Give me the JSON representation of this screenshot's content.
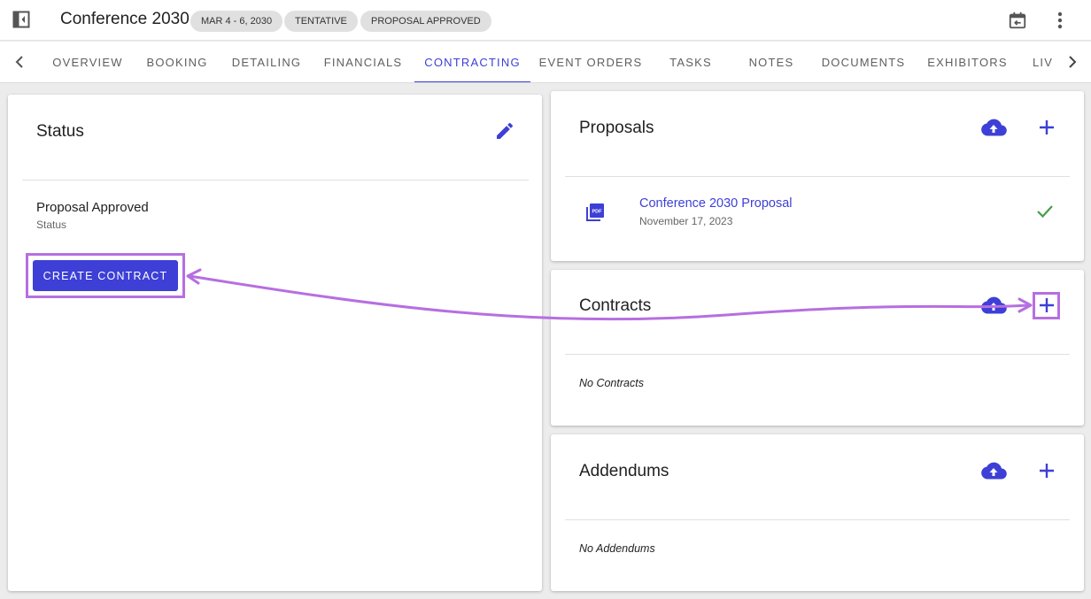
{
  "header": {
    "title": "Conference 2030",
    "chips": [
      "MAR 4 - 6, 2030",
      "TENTATIVE",
      "PROPOSAL APPROVED"
    ]
  },
  "tabs": [
    "OVERVIEW",
    "BOOKING",
    "DETAILING",
    "FINANCIALS",
    "CONTRACTING",
    "EVENT ORDERS",
    "TASKS",
    "NOTES",
    "DOCUMENTS",
    "EXHIBITORS",
    "LIV"
  ],
  "active_tab": "CONTRACTING",
  "status_card": {
    "title": "Status",
    "value": "Proposal Approved",
    "label": "Status",
    "create_button": "CREATE CONTRACT"
  },
  "proposals_card": {
    "title": "Proposals",
    "items": [
      {
        "name": "Conference 2030 Proposal",
        "date": "November 17, 2023",
        "icon": "pdf-file-icon",
        "status_icon": "check-icon"
      }
    ]
  },
  "contracts_card": {
    "title": "Contracts",
    "empty": "No Contracts"
  },
  "addendums_card": {
    "title": "Addendums",
    "empty": "No Addendums"
  },
  "colors": {
    "accent": "#3d3fd6",
    "highlight": "#b66fe0",
    "success": "#43a047",
    "chip_bg": "#e0e0e0"
  }
}
